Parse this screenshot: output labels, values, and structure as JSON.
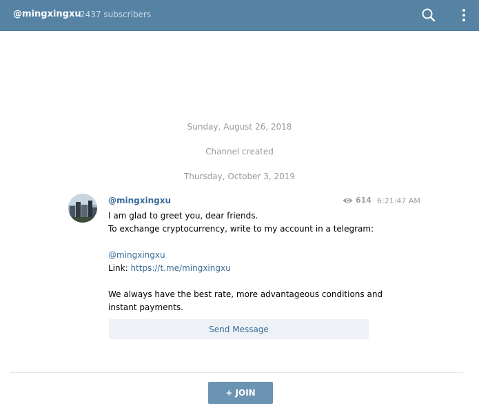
{
  "header": {
    "channel_name": "@mingxingxu",
    "subscribers": "2437 subscribers",
    "search_icon": "search-icon",
    "menu_icon": "more-vertical-icon"
  },
  "feed": {
    "date1": "Sunday, August 26, 2018",
    "service": "Channel created",
    "date2": "Thursday, October 3, 2019"
  },
  "message": {
    "author": "@mingxingxu",
    "views": "614",
    "time": "6:21:47 AM",
    "line1": "I am glad to greet you, dear friends.",
    "line2": "To exchange cryptocurrency, write to my account in a telegram:",
    "mention": "@mingxingxu",
    "link_prefix": "Link: ",
    "link": "https://t.me/mingxingxu",
    "line5": "We always have the best rate, more advantageous conditions and",
    "line6": "instant payments.",
    "send_button": "Send Message"
  },
  "footer": {
    "join_button": "+ JOIN"
  },
  "colors": {
    "header": "#5682a3",
    "link": "#3a6d99",
    "join": "#6b93b2"
  }
}
